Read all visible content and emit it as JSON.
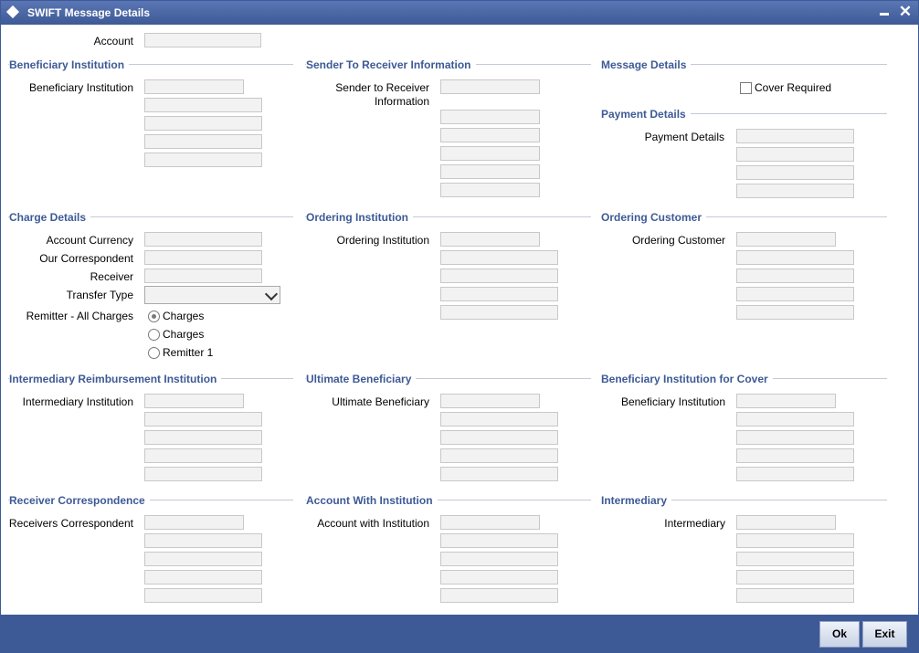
{
  "window": {
    "title": "SWIFT Message Details"
  },
  "titlebar": {
    "minimize_label": "–",
    "close_label": "✕"
  },
  "labels": {
    "account": "Account",
    "beneficiary_institution": "Beneficiary Institution",
    "sender_to_receiver_line1": "Sender to Receiver",
    "sender_to_receiver_line2": "Information",
    "cover_required": "Cover Required",
    "payment_details": "Payment Details",
    "account_currency": "Account Currency",
    "our_correspondent": "Our Correspondent",
    "receiver": "Receiver",
    "transfer_type": "Transfer Type",
    "remitter_all_charges": "Remitter - All Charges",
    "ordering_institution": "Ordering Institution",
    "ordering_customer": "Ordering Customer",
    "intermediary_institution": "Intermediary Institution",
    "ultimate_beneficiary": "Ultimate Beneficiary",
    "beneficiary_institution_cover": "Beneficiary Institution",
    "receivers_correspondent": "Receivers Correspondent",
    "account_with_institution": "Account with Institution",
    "intermediary": "Intermediary"
  },
  "sections": {
    "beneficiary_institution": "Beneficiary Institution",
    "sender_to_receiver": "Sender To Receiver Information",
    "message_details": "Message Details",
    "payment_details": "Payment Details",
    "charge_details": "Charge Details",
    "ordering_institution": "Ordering Institution",
    "ordering_customer": "Ordering Customer",
    "intermediary_reimbursement": "Intermediary Reimbursement Institution",
    "ultimate_beneficiary": "Ultimate Beneficiary",
    "beneficiary_institution_cover": "Beneficiary Institution for Cover",
    "receiver_correspondence": "Receiver Correspondence",
    "account_with_institution": "Account With Institution",
    "intermediary": "Intermediary"
  },
  "radios": [
    {
      "label": "Charges",
      "checked": true
    },
    {
      "label": "Charges",
      "checked": false
    },
    {
      "label": "Remitter 1",
      "checked": false
    }
  ],
  "fields": {
    "transfer_type_value": ""
  },
  "buttons": {
    "ok": "Ok",
    "exit": "Exit"
  },
  "colors": {
    "accent": "#3d5a96",
    "section_title": "#3d5a96",
    "input_bg": "#f2f2f2"
  }
}
